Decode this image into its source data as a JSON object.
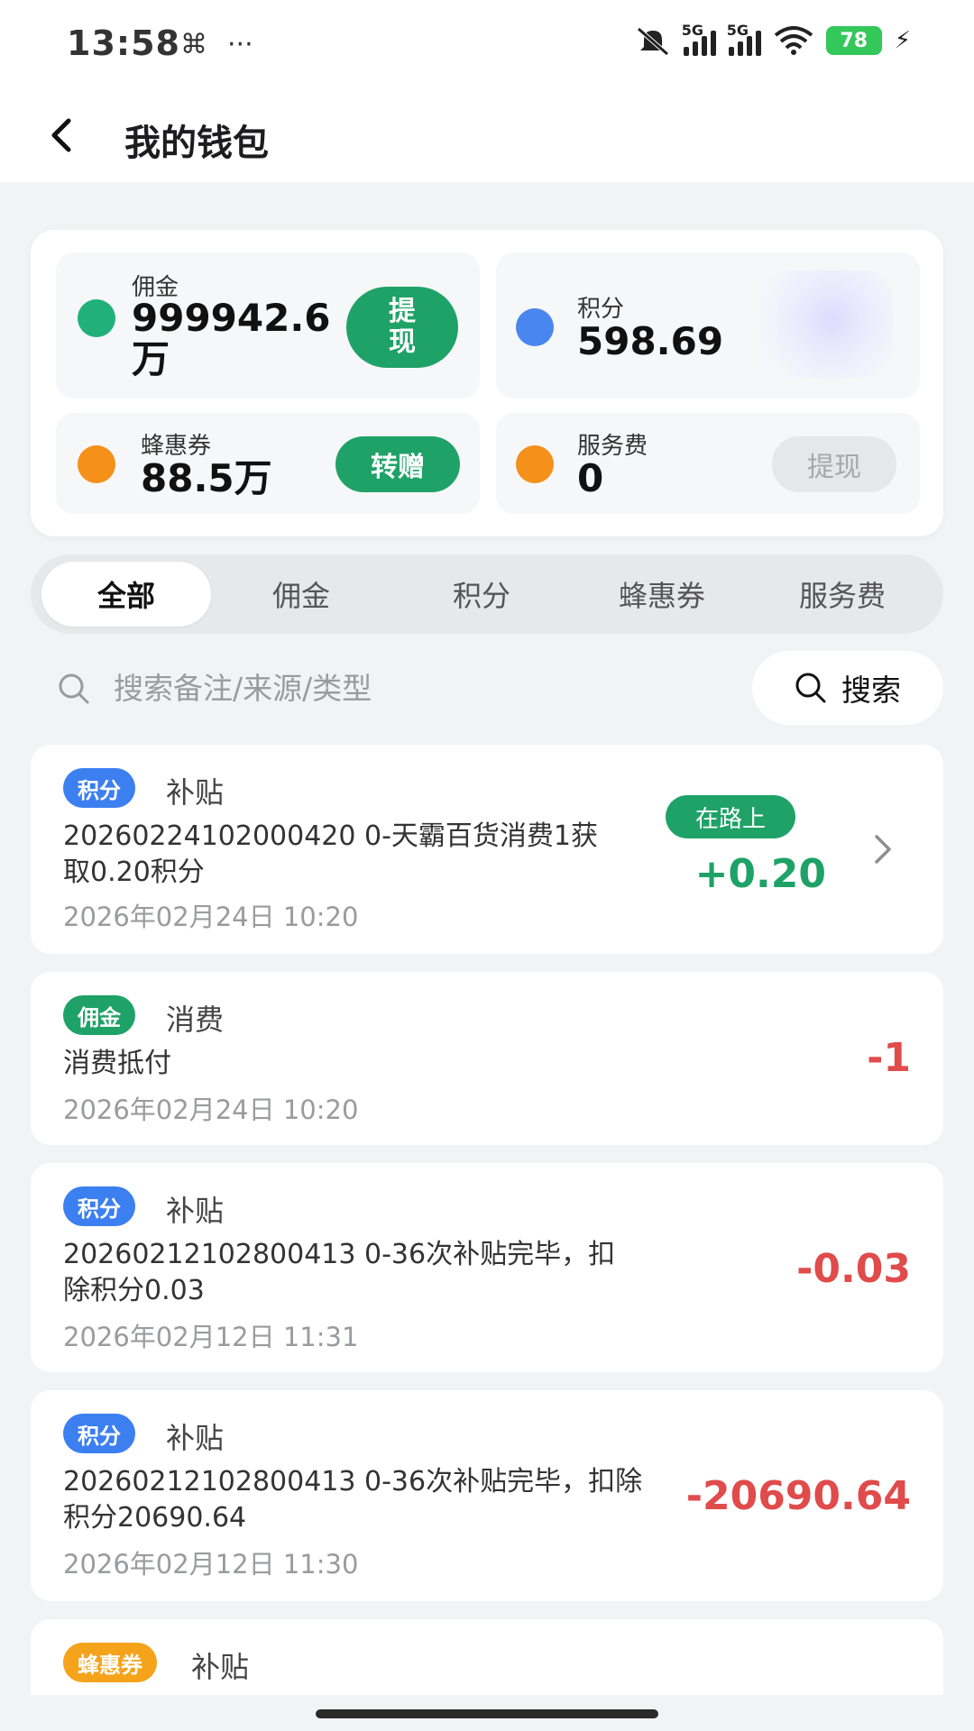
{
  "status_bar": {
    "time": "13:58",
    "net_label_1": "5G",
    "net_label_2": "5G",
    "battery": "78"
  },
  "header": {
    "title": "我的钱包"
  },
  "wallet": {
    "commission": {
      "label": "佣金",
      "value": "999942.6万",
      "action": "提现",
      "color": "#22b07a"
    },
    "points": {
      "label": "积分",
      "value": "598.69",
      "color": "#4a86f0"
    },
    "coupons": {
      "label": "蜂惠券",
      "value": "88.5万",
      "action": "转赠",
      "color": "#f5901b"
    },
    "service_fee": {
      "label": "服务费",
      "value": "0",
      "action": "提现",
      "color": "#f5901b"
    }
  },
  "tabs": [
    {
      "label": "全部",
      "active": true
    },
    {
      "label": "佣金"
    },
    {
      "label": "积分"
    },
    {
      "label": "蜂惠券"
    },
    {
      "label": "服务费"
    }
  ],
  "search": {
    "placeholder": "搜索备注/来源/类型",
    "button_label": "搜索"
  },
  "records": [
    {
      "badge": "积分",
      "type": "补贴",
      "desc": "20260224102000420 0-天霸百货消费1获取0.20积分",
      "date": "2026年02月24日 10:20",
      "status": "在路上",
      "amount": "+0.20"
    },
    {
      "badge": "佣金",
      "type": "消费",
      "desc": "消费抵付",
      "date": "2026年02月24日 10:20",
      "amount": "-1"
    },
    {
      "badge": "积分",
      "type": "补贴",
      "desc": "20260212102800413 0-36次补贴完毕，扣除积分0.03",
      "date": "2026年02月12日 11:31",
      "amount": "-0.03"
    },
    {
      "badge": "积分",
      "type": "补贴",
      "desc": "20260212102800413 0-36次补贴完毕，扣除积分20690.64",
      "date": "2026年02月12日 11:30",
      "amount": "-20690.64"
    },
    {
      "badge": "蜂惠券",
      "type": "补贴"
    }
  ]
}
